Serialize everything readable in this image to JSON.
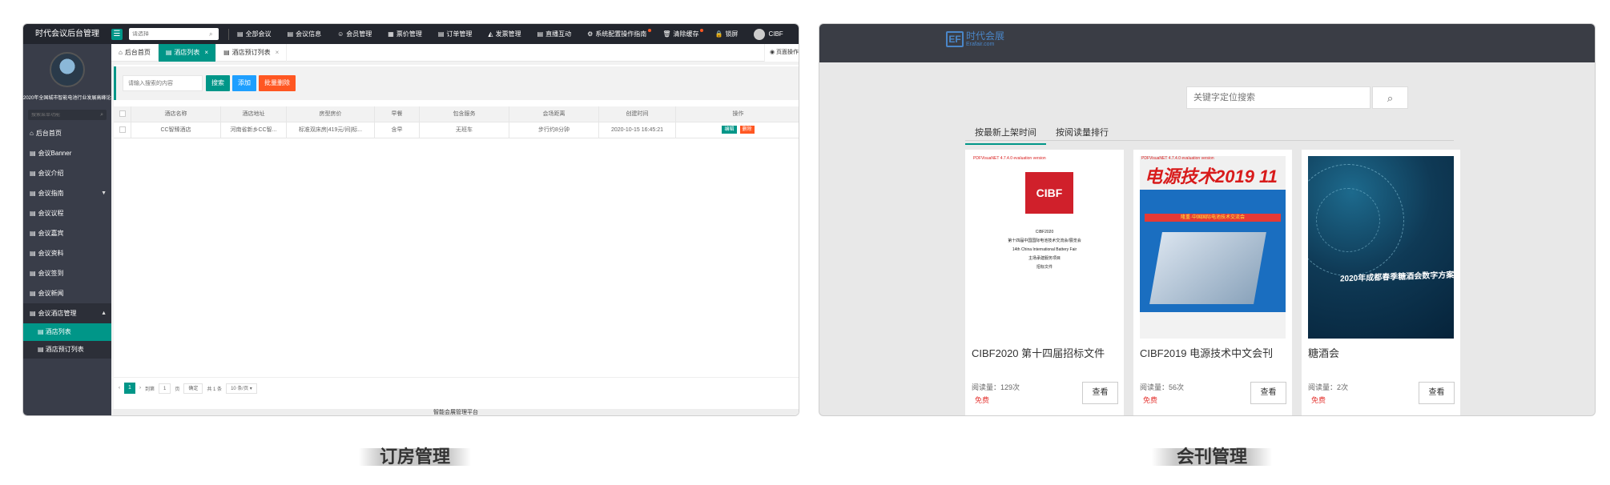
{
  "admin": {
    "brand": "时代会议后台管理",
    "top_search_placeholder": "请选择",
    "top_nav": [
      "全部会议",
      "会议信息",
      "会员管理",
      "票价管理",
      "订单管理",
      "发票管理",
      "直播互动",
      "系统配置操作指南",
      "清除缓存",
      "锁屏"
    ],
    "user_name": "CIBF",
    "org_name": "2020年全国城市智能电池行业发展高峰论坛",
    "side_search_placeholder": "搜索菜单功能",
    "side_items": [
      "后台首页",
      "会议Banner",
      "会议介绍",
      "会议指南",
      "会议议程",
      "会议嘉宾",
      "会议资料",
      "会议签到",
      "会议新闻",
      "会议酒店管理"
    ],
    "side_sub_items": [
      "酒店列表",
      "酒店预订列表"
    ],
    "tabs": [
      "后台首页",
      "酒店列表",
      "酒店预订列表"
    ],
    "page_op": "页面操作",
    "keyword_placeholder": "请输入搜索的内容",
    "buttons": {
      "search": "搜索",
      "add": "添加",
      "batch_delete": "批量删除"
    },
    "table": {
      "headers": [
        "酒店名称",
        "酒店地址",
        "房型房价",
        "早餐",
        "包含服务",
        "会场距离",
        "创建时间",
        "操作"
      ],
      "rows": [
        [
          "CC智臻酒店",
          "河南省新乡CC智...",
          "标准双床房|419元/间|标...",
          "含早",
          "无班车",
          "步行约8分钟",
          "2020-10-15 16:45:21"
        ]
      ],
      "row_actions": [
        "编辑",
        "删除"
      ]
    },
    "pager": {
      "current": "1",
      "goto_label": "到第",
      "goto_value": "1",
      "page_unit": "页",
      "confirm": "确定",
      "total": "共 1 条",
      "page_size": "10 条/页"
    },
    "footer": "智能会展管理平台"
  },
  "journal": {
    "logo_text": "时代会展",
    "logo_sub": "Erafair.com",
    "search_placeholder": "关键字定位搜索",
    "tabs": [
      "按最新上架时间",
      "按阅读量排行"
    ],
    "items": [
      {
        "title": "CIBF2020 第十四届招标文件",
        "reads": "阅读量：129次",
        "price": "免费",
        "view": "查看"
      },
      {
        "title": "CIBF2019 电源技术中文会刊",
        "reads": "阅读量：56次",
        "price": "免费",
        "view": "查看"
      },
      {
        "title": "糖酒会",
        "reads": "阅读量：2次",
        "price": "免费",
        "view": "查看"
      }
    ],
    "cover1": {
      "watermark": "PDFVisuaNET 4.7.4.0 evaluation version",
      "logo": "CIBF",
      "lines": [
        "CIBF2020",
        "第十四届中国国际电池技术交流会/展览会",
        "14th China International Battery Fair",
        "主场承建服务项目",
        "招标文件"
      ]
    },
    "cover2": {
      "watermark": "PDFVisuaNET 4.7.4.0 evaluation version",
      "big": "电源技术2019 11",
      "mid": "隆重·中国国际电池技术交流会"
    },
    "cover3": {
      "text": "2020年成都春季糖酒会数字方案"
    }
  },
  "captions": [
    "订房管理",
    "会刊管理"
  ]
}
